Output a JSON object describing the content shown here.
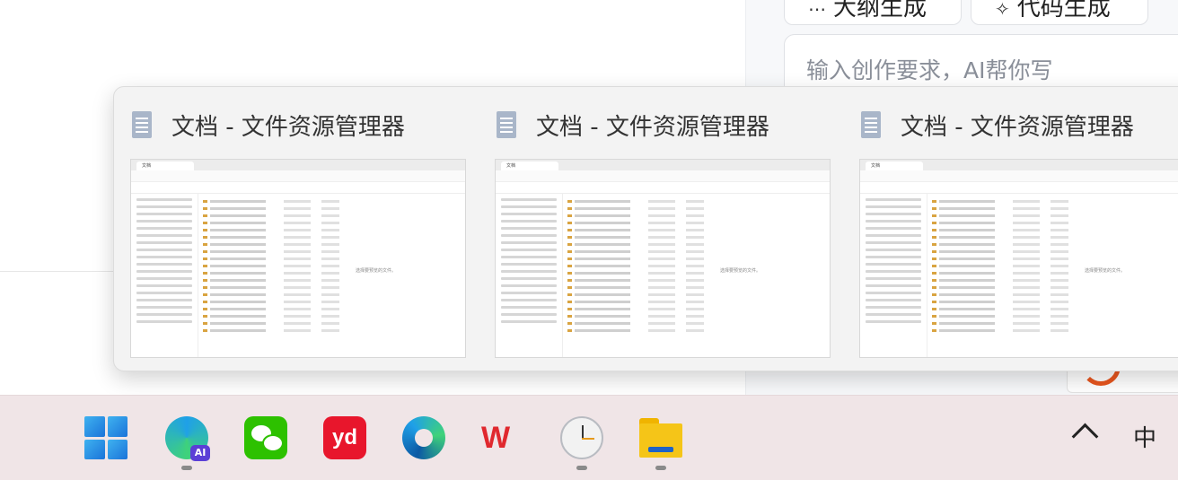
{
  "ai_panel": {
    "buttons": [
      {
        "icon": "outline-icon",
        "label": "大纲生成"
      },
      {
        "icon": "code-icon",
        "label": "代码生成"
      }
    ],
    "prompt_placeholder": "输入创作要求，AI帮你写"
  },
  "taskbar_previews": [
    {
      "title": "文档 - 文件资源管理器"
    },
    {
      "title": "文档 - 文件资源管理器"
    },
    {
      "title": "文档 - 文件资源管理器"
    }
  ],
  "preview_content": {
    "tab_label": "文档",
    "empty_folder_note": "选择要预览的文件。"
  },
  "taskbar": {
    "apps": [
      {
        "name": "start",
        "icon": "windows-logo-icon",
        "running": false
      },
      {
        "name": "edge-ai",
        "icon": "edge-ai-icon",
        "running": true
      },
      {
        "name": "wechat",
        "icon": "wechat-icon",
        "running": false
      },
      {
        "name": "youdao",
        "icon": "youdao-icon",
        "running": false
      },
      {
        "name": "edge",
        "icon": "edge-icon",
        "running": false
      },
      {
        "name": "wps",
        "icon": "wps-icon",
        "running": false
      },
      {
        "name": "clock",
        "icon": "clock-icon",
        "running": true
      },
      {
        "name": "file-explorer",
        "icon": "folder-icon",
        "running": true
      }
    ],
    "tray": {
      "ime_label": "中"
    }
  },
  "colors": {
    "taskbar_bg": "#f0e5e7",
    "popup_bg": "#f3f3f3",
    "folder_yellow": "#f5c518",
    "wps_red": "#e0282e"
  }
}
